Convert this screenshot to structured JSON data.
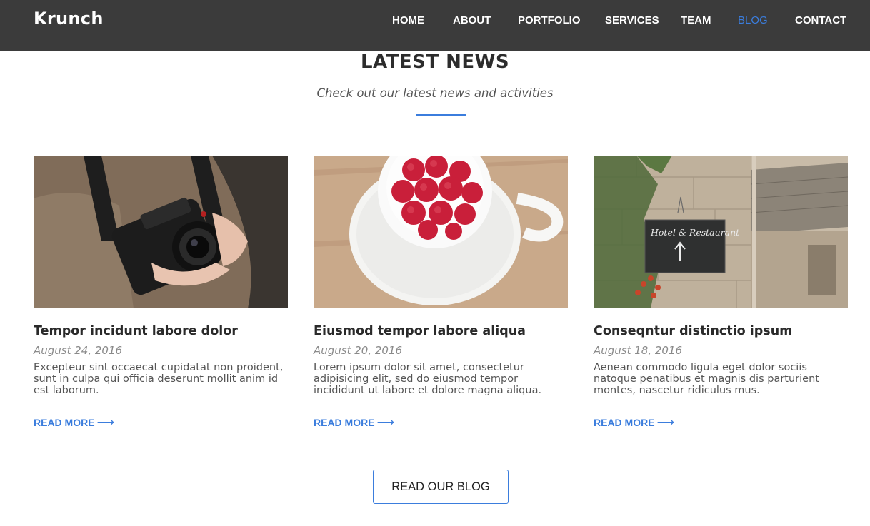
{
  "header": {
    "brand": "Krunch",
    "nav": [
      {
        "label": "HOME",
        "active": false
      },
      {
        "label": "ABOUT",
        "active": false
      },
      {
        "label": "PORTFOLIO",
        "active": false
      },
      {
        "label": "SERVICES",
        "active": false
      },
      {
        "label": "TEAM",
        "active": false
      },
      {
        "label": "BLOG",
        "active": true
      },
      {
        "label": "CONTACT",
        "active": false
      }
    ]
  },
  "section": {
    "title": "LATEST NEWS",
    "subtitle": "Check out our latest news and activities"
  },
  "posts": [
    {
      "title": "Tempor incidunt labore dolor",
      "date": "August 24, 2016",
      "excerpt": "Excepteur sint occaecat cupidatat non proident, sunt in culpa qui officia deserunt mollit anim id est laborum.",
      "read_more": "READ MORE",
      "image": "camera-photo"
    },
    {
      "title": "Eiusmod tempor labore aliqua",
      "date": "August 20, 2016",
      "excerpt": "Lorem ipsum dolor sit amet, consectetur adipisicing elit, sed do eiusmod tempor incididunt ut labore et dolore magna aliqua.",
      "read_more": "READ MORE",
      "image": "raspberries-cup-photo"
    },
    {
      "title": "Conseqntur distinctio ipsum",
      "date": "August 18, 2016",
      "excerpt": "Aenean commodo ligula eget dolor sociis natoque penatibus et magnis dis parturient montes, nascetur ridiculus mus.",
      "read_more": "READ MORE",
      "image": "hotel-sign-photo"
    }
  ],
  "sign_text": "Hotel & Restaurant",
  "cta": {
    "label": "READ OUR BLOG"
  },
  "colors": {
    "accent": "#3b7ddd",
    "navbar": "#3b3b3b"
  },
  "icons": {
    "read_more_arrow": "arrow-right-icon"
  }
}
